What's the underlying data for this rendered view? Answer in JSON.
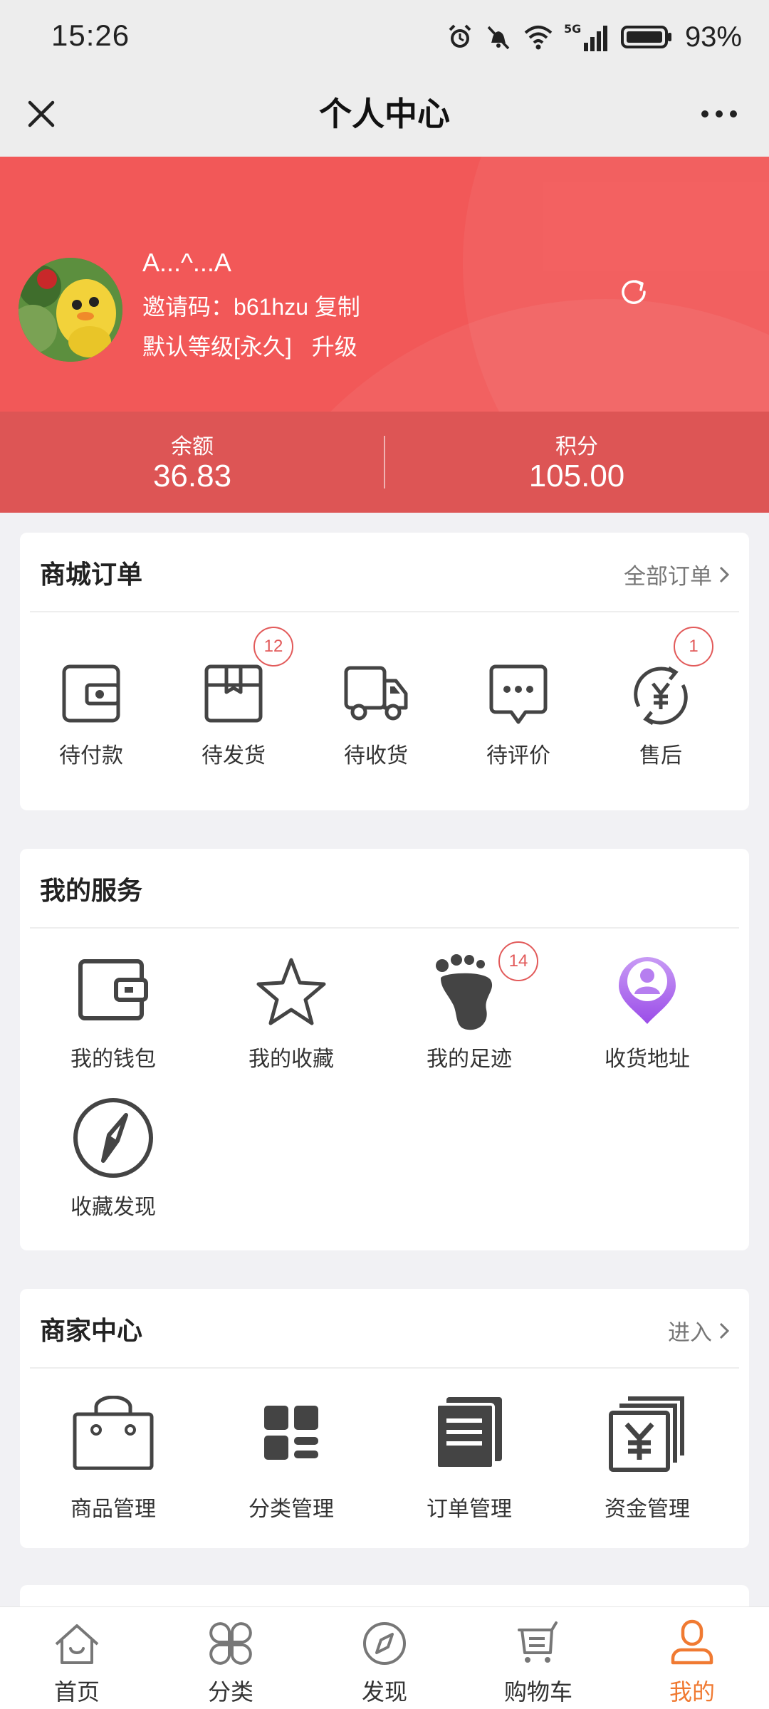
{
  "status_bar": {
    "time": "15:26",
    "battery": "93%",
    "network": "5G"
  },
  "title_bar": {
    "title": "个人中心",
    "close_icon": "close-icon",
    "more_icon": "more-icon"
  },
  "profile": {
    "name": "A...^...A",
    "invite_label": "邀请码：",
    "invite_code": "b61hzu",
    "copy_label": "复制",
    "level": "默认等级[永久]",
    "upgrade_label": "升级",
    "balance_label": "余额",
    "balance_value": "36.83",
    "points_label": "积分",
    "points_value": "105.00",
    "header_color": "#f25858"
  },
  "orders": {
    "title": "商城订单",
    "link_label": "全部订单",
    "items": [
      {
        "label": "待付款",
        "icon": "wallet-outline-icon",
        "badge": ""
      },
      {
        "label": "待发货",
        "icon": "package-icon",
        "badge": "12"
      },
      {
        "label": "待收货",
        "icon": "truck-icon",
        "badge": ""
      },
      {
        "label": "待评价",
        "icon": "comment-icon",
        "badge": ""
      },
      {
        "label": "售后",
        "icon": "refund-icon",
        "badge": "1"
      }
    ]
  },
  "services": {
    "title": "我的服务",
    "items": [
      {
        "label": "我的钱包",
        "icon": "wallet-icon",
        "badge": ""
      },
      {
        "label": "我的收藏",
        "icon": "star-icon",
        "badge": ""
      },
      {
        "label": "我的足迹",
        "icon": "footprint-icon",
        "badge": "14"
      },
      {
        "label": "收货地址",
        "icon": "location-pin-icon",
        "badge": ""
      },
      {
        "label": "收藏发现",
        "icon": "compass-icon",
        "badge": ""
      }
    ]
  },
  "merchant": {
    "title": "商家中心",
    "link_label": "进入",
    "items": [
      {
        "label": "商品管理",
        "icon": "shopping-bag-icon"
      },
      {
        "label": "分类管理",
        "icon": "category-grid-icon"
      },
      {
        "label": "订单管理",
        "icon": "document-icon"
      },
      {
        "label": "资金管理",
        "icon": "funds-icon"
      }
    ]
  },
  "bottom_nav": {
    "items": [
      {
        "label": "首页",
        "icon": "home-icon"
      },
      {
        "label": "分类",
        "icon": "category-icon"
      },
      {
        "label": "发现",
        "icon": "discover-icon"
      },
      {
        "label": "购物车",
        "icon": "cart-icon"
      },
      {
        "label": "我的",
        "icon": "profile-icon",
        "active": true
      }
    ],
    "active_color": "#f07a32"
  }
}
